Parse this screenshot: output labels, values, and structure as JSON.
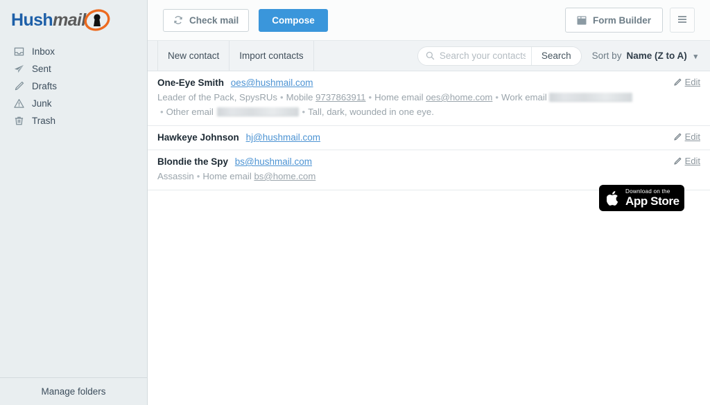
{
  "brand": {
    "logo_part1": "Hush",
    "logo_part2": "mail",
    "accent_orange": "#ec6a1f",
    "accent_blue": "#1d5fa8",
    "primary_button": "#3a96db"
  },
  "sidebar": {
    "items": [
      {
        "label": "Inbox",
        "icon": "inbox-icon"
      },
      {
        "label": "Sent",
        "icon": "paper-plane-icon"
      },
      {
        "label": "Drafts",
        "icon": "pencil-icon"
      },
      {
        "label": "Junk",
        "icon": "warning-triangle-icon"
      },
      {
        "label": "Trash",
        "icon": "trash-icon"
      }
    ],
    "footer_label": "Manage folders"
  },
  "toolbar": {
    "check_mail_label": "Check mail",
    "check_mail_icon": "refresh-icon",
    "compose_label": "Compose",
    "form_builder_label": "Form Builder",
    "form_builder_icon": "window-icon",
    "menu_icon": "hamburger-menu-icon"
  },
  "subtoolbar": {
    "new_contact_label": "New contact",
    "import_contacts_label": "Import contacts",
    "search": {
      "icon": "search-icon",
      "placeholder": "Search your contacts",
      "value": "",
      "button_label": "Search"
    },
    "sort": {
      "label": "Sort by",
      "value": "Name (Z to A)",
      "caret_icon": "chevron-down-icon"
    }
  },
  "contacts": {
    "edit_label": "Edit",
    "edit_icon": "pencil-icon",
    "rows": [
      {
        "name": "One-Eye Smith",
        "email": "oes@hushmail.com",
        "details": [
          {
            "type": "text",
            "text": "Leader of the Pack, SpysRUs"
          },
          {
            "type": "label",
            "text": "Mobile"
          },
          {
            "type": "link",
            "text": "9737863911"
          },
          {
            "type": "label",
            "text": "Home email"
          },
          {
            "type": "link",
            "text": "oes@home.com"
          },
          {
            "type": "label",
            "text": "Work email"
          },
          {
            "type": "redacted",
            "text": ""
          },
          {
            "type": "label",
            "text": "Other email"
          },
          {
            "type": "redacted",
            "text": ""
          },
          {
            "type": "text",
            "text": "Tall, dark, wounded in one eye."
          }
        ]
      },
      {
        "name": "Hawkeye Johnson",
        "email": "hj@hushmail.com",
        "details": []
      },
      {
        "name": "Blondie the Spy",
        "email": "bs@hushmail.com",
        "details": [
          {
            "type": "text",
            "text": "Assassin"
          },
          {
            "type": "label",
            "text": "Home email"
          },
          {
            "type": "link",
            "text": "bs@home.com"
          }
        ]
      }
    ]
  },
  "app_store_badge": {
    "line1": "Download on the",
    "line2": "App Store",
    "icon": "apple-logo-icon"
  }
}
